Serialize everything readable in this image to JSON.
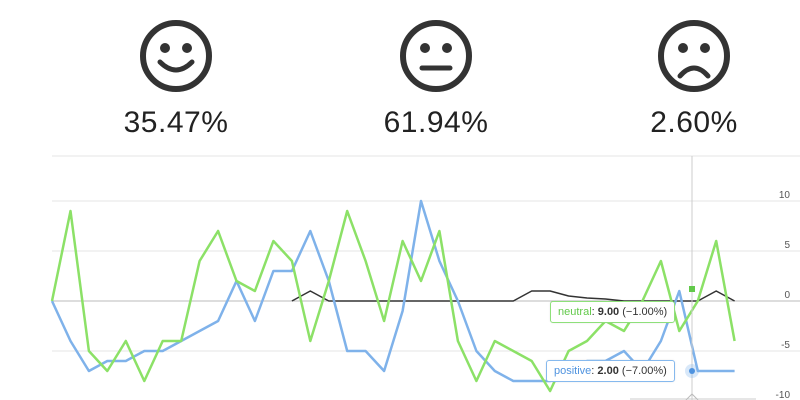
{
  "sentiment": [
    {
      "name": "positive",
      "icon": "smiley-face-icon",
      "percent": "35.47%"
    },
    {
      "name": "neutral",
      "icon": "neutral-face-icon",
      "percent": "61.94%"
    },
    {
      "name": "negative",
      "icon": "sad-face-icon",
      "percent": "2.60%"
    }
  ],
  "colors": {
    "neutral": "#8ce167",
    "positive": "#7fb2ea",
    "negative": "#333333",
    "grid": "#e6e6e6",
    "axis": "#bbbbbb"
  },
  "tooltips": {
    "neutral": {
      "name": "neutral",
      "value": "9.00",
      "change": "(−1.00%)"
    },
    "positive": {
      "name": "positive",
      "value": "2.00",
      "change": "(−7.00%)"
    }
  },
  "chart_data": {
    "type": "line",
    "ylim": [
      -10,
      15
    ],
    "yticks": [
      10,
      5,
      0,
      -5,
      -10
    ],
    "x": [
      0,
      1,
      2,
      3,
      4,
      5,
      6,
      7,
      8,
      9,
      10,
      11,
      12,
      13,
      14,
      15,
      16,
      17,
      18,
      19,
      20,
      21,
      22,
      23,
      24,
      25,
      26,
      27,
      28,
      29,
      30,
      31,
      32,
      33,
      34,
      35,
      36,
      37,
      38,
      39,
      40
    ],
    "series": [
      {
        "name": "neutral",
        "color": "#8ce167",
        "values": [
          0,
          9,
          -5,
          -7,
          -4,
          -8,
          -4,
          -4,
          4,
          7,
          2,
          1,
          6,
          4,
          -4,
          2,
          9,
          4,
          -2,
          6,
          2,
          7,
          -4,
          -8,
          -4,
          -5,
          -6,
          -9,
          -5,
          -4,
          -2,
          -3,
          0,
          4,
          -3,
          0,
          6,
          -4,
          null,
          null,
          null
        ]
      },
      {
        "name": "positive",
        "color": "#7fb2ea",
        "values": [
          0,
          -4,
          -7,
          -6,
          -6,
          -5,
          -5,
          -4,
          -3,
          -2,
          2,
          -2,
          3,
          3,
          7,
          2,
          -5,
          -5,
          -7,
          -1,
          10,
          4,
          0,
          -5,
          -7,
          -8,
          -8,
          -8,
          -7,
          -6,
          -6,
          -5,
          -7,
          -4,
          1,
          -7,
          -7,
          -7,
          null,
          null,
          null
        ]
      },
      {
        "name": "negative",
        "color": "#333333",
        "values": [
          null,
          null,
          null,
          null,
          null,
          null,
          null,
          null,
          null,
          null,
          null,
          null,
          null,
          0,
          1,
          0,
          0,
          0,
          0,
          0,
          0,
          0,
          0,
          0,
          0,
          0,
          1,
          1,
          0.5,
          0.3,
          0.2,
          0,
          0,
          0,
          0,
          0,
          1,
          0,
          null,
          null,
          null
        ]
      }
    ]
  }
}
